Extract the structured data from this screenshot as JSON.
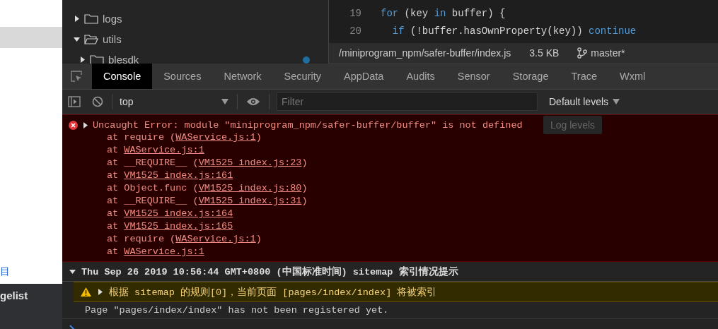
{
  "left_panel": {
    "link_text": "目",
    "nav_item": "gelist"
  },
  "file_tree": {
    "items": [
      {
        "name": "logs",
        "expanded": false,
        "modified": false
      },
      {
        "name": "utils",
        "expanded": true,
        "modified": false,
        "children": [
          {
            "name": "blesdk",
            "expanded": false,
            "modified": true
          }
        ]
      }
    ]
  },
  "editor": {
    "lines": [
      {
        "number": "19",
        "tokens": [
          {
            "text": "for",
            "kind": "keyword"
          },
          {
            "text": " (key ",
            "kind": "plain"
          },
          {
            "text": "in",
            "kind": "keyword"
          },
          {
            "text": " buffer) {",
            "kind": "plain"
          }
        ]
      },
      {
        "number": "20",
        "tokens": [
          {
            "text": "  if",
            "kind": "keyword"
          },
          {
            "text": " (!buffer.hasOwnProperty(key)) ",
            "kind": "plain"
          },
          {
            "text": "continue",
            "kind": "keyword"
          }
        ]
      }
    ]
  },
  "status_bar": {
    "path": "/miniprogram_npm/safer-buffer/index.js",
    "size": "3.5 KB",
    "branch": "master*"
  },
  "devtools": {
    "tabs": [
      {
        "label": "Console",
        "selected": true
      },
      {
        "label": "Sources",
        "selected": false
      },
      {
        "label": "Network",
        "selected": false
      },
      {
        "label": "Security",
        "selected": false
      },
      {
        "label": "AppData",
        "selected": false
      },
      {
        "label": "Audits",
        "selected": false
      },
      {
        "label": "Sensor",
        "selected": false
      },
      {
        "label": "Storage",
        "selected": false
      },
      {
        "label": "Trace",
        "selected": false
      },
      {
        "label": "Wxml",
        "selected": false
      }
    ],
    "toolbar": {
      "context": "top",
      "filter_placeholder": "Filter",
      "levels": "Default levels"
    },
    "tooltip": "Log levels",
    "messages": [
      {
        "kind": "error",
        "expanded": false,
        "text": "Uncaught Error: module \"miniprogram_npm/safer-buffer/buffer\" is not defined",
        "stack": [
          {
            "text": "at require (",
            "link": "WAService.js:1",
            "end": ")"
          },
          {
            "text": "at ",
            "link": "WAService.js:1"
          },
          {
            "text": "at __REQUIRE__ (",
            "link": "VM1525 index.js:23",
            "end": ")"
          },
          {
            "text": "at ",
            "link": "VM1525 index.js:161"
          },
          {
            "text": "at Object.func (",
            "link": "VM1525 index.js:80",
            "end": ")"
          },
          {
            "text": "at __REQUIRE__ (",
            "link": "VM1525 index.js:31",
            "end": ")"
          },
          {
            "text": "at ",
            "link": "VM1525 index.js:164"
          },
          {
            "text": "at ",
            "link": "VM1525 index.js:165"
          },
          {
            "text": "at require (",
            "link": "WAService.js:1",
            "end": ")"
          },
          {
            "text": "at ",
            "link": "WAService.js:1"
          }
        ]
      },
      {
        "kind": "group",
        "expanded": true,
        "text": "Thu Sep 26 2019 10:56:44 GMT+0800 (中国标准时间) sitemap 索引情况提示",
        "children": [
          {
            "kind": "warning",
            "expanded": false,
            "text": "根据 sitemap 的规则[0]，当前页面 [pages/index/index] 将被索引"
          }
        ]
      },
      {
        "kind": "log",
        "text": "Page \"pages/index/index\" has not been registered yet."
      }
    ]
  }
}
